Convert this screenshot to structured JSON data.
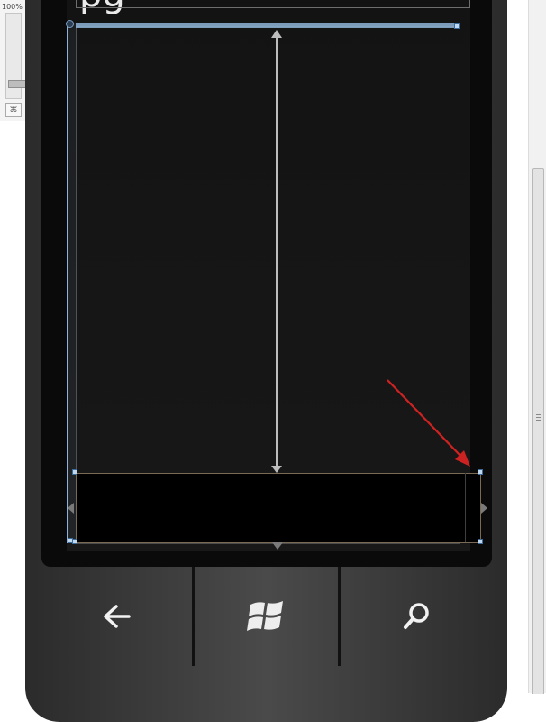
{
  "zoom": {
    "level": "100%",
    "fit_label": "⌘"
  },
  "designer": {
    "page_title": "pg"
  },
  "icons": {
    "back": "back-arrow-icon",
    "start": "windows-logo-icon",
    "search": "search-icon"
  },
  "colors": {
    "selection": "#8fb3d8",
    "annotation_arrow": "#cc2222",
    "phone_body": "#3a3a3a"
  }
}
